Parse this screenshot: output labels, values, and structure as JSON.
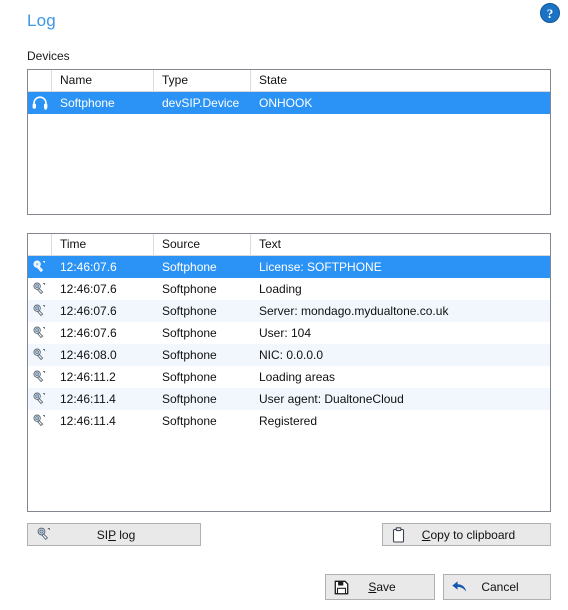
{
  "window": {
    "title": "Log"
  },
  "help": {
    "icon": "help-question-icon",
    "glyph": "?"
  },
  "devices": {
    "section_label": "Devices",
    "columns": [
      "",
      "Name",
      "Type",
      "State"
    ],
    "rows": [
      {
        "icon": "headset-icon",
        "name": "Softphone",
        "type": "devSIP.Device",
        "state": "ONHOOK",
        "selected": true
      }
    ]
  },
  "log": {
    "columns": [
      "",
      "Time",
      "Source",
      "Text"
    ],
    "rows": [
      {
        "icon": "log-entry-icon",
        "time": "12:46:07.6",
        "source": "Softphone",
        "text": "License: SOFTPHONE",
        "selected": true
      },
      {
        "icon": "log-entry-icon",
        "time": "12:46:07.6",
        "source": "Softphone",
        "text": "Loading",
        "selected": false
      },
      {
        "icon": "log-entry-icon",
        "time": "12:46:07.6",
        "source": "Softphone",
        "text": "Server: mondago.mydualtone.co.uk",
        "selected": false
      },
      {
        "icon": "log-entry-icon",
        "time": "12:46:07.6",
        "source": "Softphone",
        "text": "User: 104",
        "selected": false
      },
      {
        "icon": "log-entry-icon",
        "time": "12:46:08.0",
        "source": "Softphone",
        "text": "NIC: 0.0.0.0",
        "selected": false
      },
      {
        "icon": "log-entry-icon",
        "time": "12:46:11.2",
        "source": "Softphone",
        "text": "Loading areas",
        "selected": false
      },
      {
        "icon": "log-entry-icon",
        "time": "12:46:11.4",
        "source": "Softphone",
        "text": "User agent: DualtoneCloud",
        "selected": false
      },
      {
        "icon": "log-entry-icon",
        "time": "12:46:11.4",
        "source": "Softphone",
        "text": "Registered",
        "selected": false
      }
    ]
  },
  "buttons": {
    "sip_log": {
      "label_before": "SI",
      "accel": "P",
      "label_after": " log",
      "icon": "log-entry-icon"
    },
    "copy_clipboard": {
      "accel": "C",
      "label_after": "opy to clipboard",
      "icon": "clipboard-icon"
    },
    "save": {
      "accel": "S",
      "label_after": "ave",
      "icon": "floppy-save-icon"
    },
    "cancel": {
      "label": "Cancel",
      "icon": "back-arrow-icon"
    }
  },
  "colors": {
    "title": "#3e97e8",
    "selection": "#2b93f5",
    "alt_row": "#f1f7fd",
    "accent_blue": "#1a73c4",
    "panel_border": "#828790"
  }
}
